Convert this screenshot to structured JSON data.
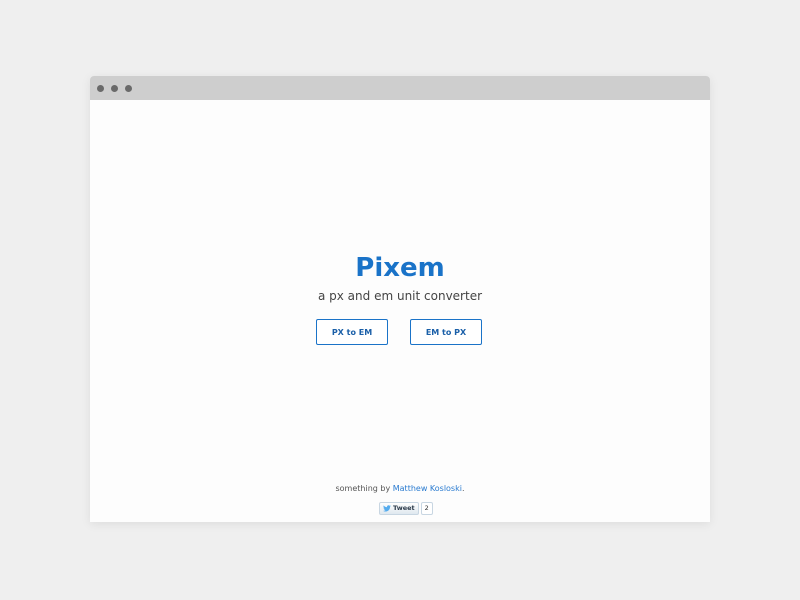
{
  "app": {
    "title": "Pixem",
    "subtitle": "a px and em unit converter"
  },
  "buttons": {
    "px_to_em": "PX to EM",
    "em_to_px": "EM to PX"
  },
  "footer": {
    "prefix": "something by ",
    "author": "Matthew Kosloski",
    "suffix": "."
  },
  "tweet": {
    "label": "Tweet",
    "count": "2",
    "icon": "twitter-bird-icon"
  },
  "colors": {
    "accent": "#1a73c8",
    "titlebar": "#cecece",
    "background": "#efefef"
  }
}
